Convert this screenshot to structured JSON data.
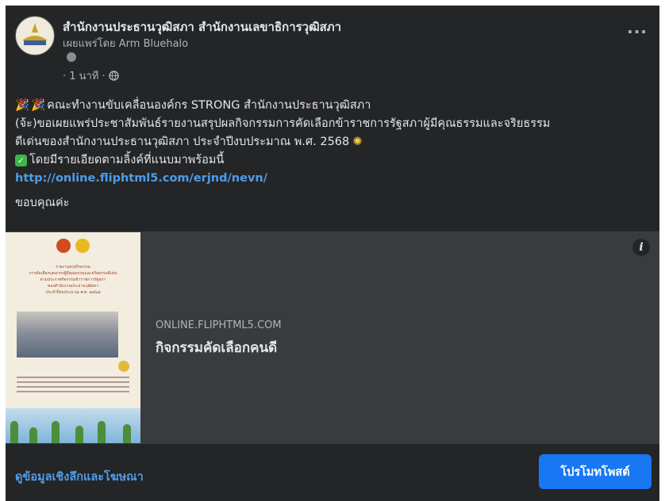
{
  "post": {
    "page_name": "สำนักงานประธานวุฒิสภา สำนักงานเลขาธิการวุฒิสภา",
    "published_by": "เผยแพร่โดย Arm Bluehalo",
    "time": "· 1 นาที ·",
    "audience_icon": "globe-icon",
    "more_icon": "more-options-icon",
    "text_lines": [
      "คณะทำงานขับเคลื่อนองค์กร STRONG สำนักงานประธานวุฒิสภา",
      "(จ้ะ)ขอเผยแพร่ประชาสัมพันธ์รายงานสรุปผลกิจกรรมการคัดเลือกข้าราชการรัฐสภาผู้มีคุณธรรมและจริยธรรม",
      "ดีเด่นของสำนักงานประธานวุฒิสภา ประจำปีงบประมาณ พ.ศ. 2568",
      "โดยมีรายเอียดตามลิ้งค์ที่แนบมาพร้อมนี้"
    ],
    "link_url": "http://online.fliphtml5.com/erjnd/nevn/",
    "closing": "ขอบคุณค่ะ"
  },
  "preview": {
    "domain": "ONLINE.FLIPHTML5.COM",
    "title": "กิจกรรมคัดเลือกคนดี",
    "thumbnail_lines": [
      "รายงานสรุปกิจกรรม",
      "การคัดเลือกบุคลากรผู้มีคุณธรรมและจริยธรรมดีเด่น",
      "ตามประกาศกิจกรรมข้าราชการรัฐสภา",
      "ของสำนักงานประธานวุฒิสภา",
      "ประจำปีงบประมาณ พ.ศ. ๒๕๖๘"
    ]
  },
  "footer": {
    "insights_label": "ดูข้อมูลเชิงลึกและโฆษณา",
    "boost_label": "โปรโมทโพสต์"
  },
  "colors": {
    "card_bg": "#242526",
    "link": "#4e9ce8",
    "boost_button": "#1877f2"
  }
}
